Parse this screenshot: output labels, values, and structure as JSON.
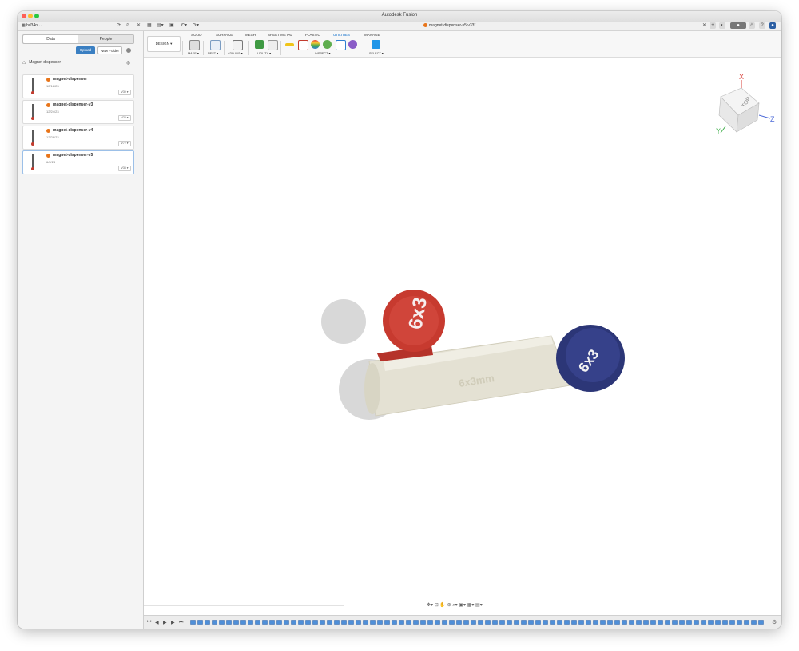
{
  "window": {
    "title": "Autodesk Fusion"
  },
  "appbar": {
    "team": "bd34n",
    "doc_tab": "magnet-dispenser-v5 v33*"
  },
  "data_panel": {
    "tabs": [
      "Data",
      "People"
    ],
    "upload_label": "Upload",
    "new_folder_label": "New Folder",
    "breadcrumb": "Magnet dispenser",
    "files": [
      {
        "name": "magnet-dispenser",
        "date": "12/18/23",
        "version": "V39 ▾"
      },
      {
        "name": "magnet-dispenser-v3",
        "date": "12/24/23",
        "version": "V23 ▾"
      },
      {
        "name": "magnet-dispenser-v4",
        "date": "12/28/23",
        "version": "V72 ▾"
      },
      {
        "name": "magnet-dispenser-v5",
        "date": "6/2/24",
        "version": "V33 ▾"
      }
    ]
  },
  "toolbar": {
    "workspace": "DESIGN ▾",
    "tabs": [
      "SOLID",
      "SURFACE",
      "MESH",
      "SHEET METAL",
      "PLASTIC",
      "UTILITIES",
      "MANAGE"
    ],
    "active_tab": "UTILITIES",
    "groups": [
      "MAKE ▾",
      "NEST ▾",
      "ADD-INS ▾",
      "UTILITY ▾",
      "INSPECT ▾",
      "SELECT ▾"
    ]
  },
  "viewcube": {
    "face": "TOP",
    "axis_x": "X",
    "axis_y": "Y",
    "axis_z": "Z"
  },
  "model": {
    "red_cap_label": "6x3",
    "blue_cap_label": "6x3",
    "body_engraving": "6x3mm",
    "colors": {
      "red": "#c73a2f",
      "blue": "#2c3677",
      "body": "#e4e1d3"
    }
  }
}
